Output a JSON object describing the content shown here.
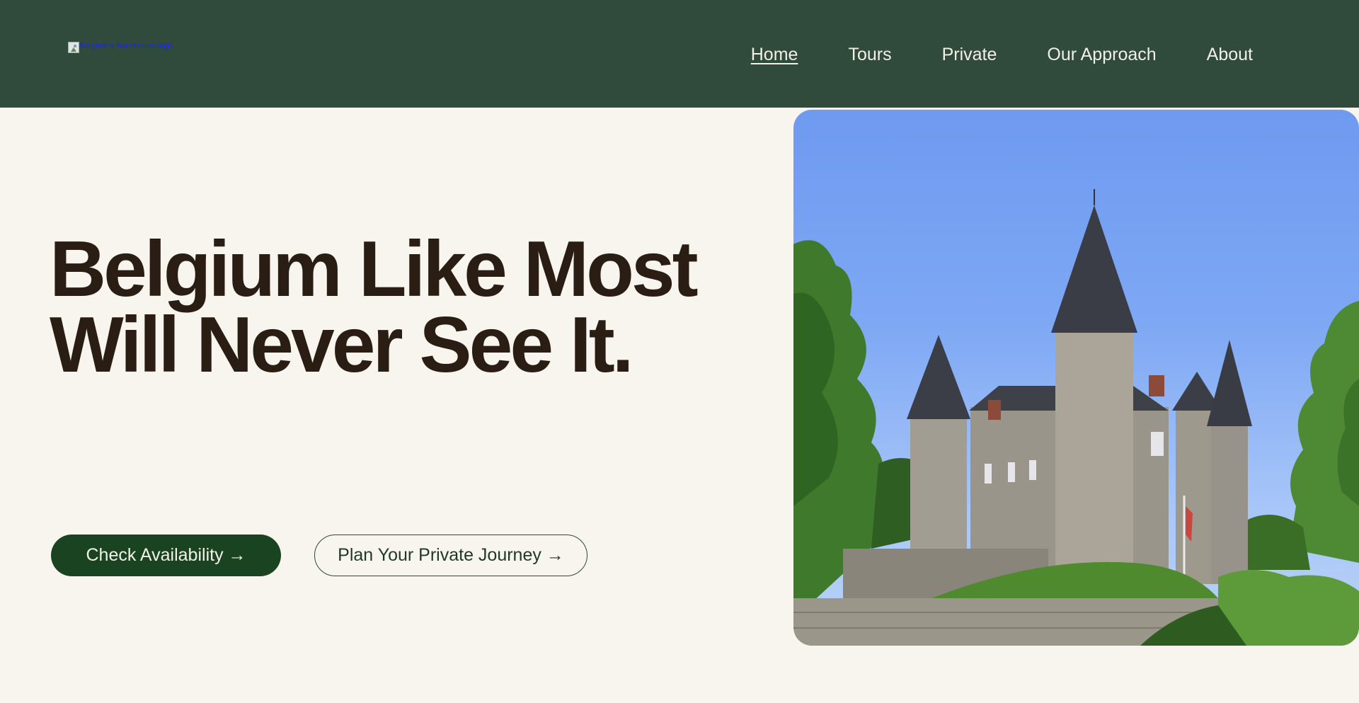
{
  "header": {
    "logo_alt": "Belgium's-Wanderlust-logo",
    "nav": [
      {
        "label": "Home",
        "active": true
      },
      {
        "label": "Tours",
        "active": false
      },
      {
        "label": "Private",
        "active": false
      },
      {
        "label": "Our Approach",
        "active": false
      },
      {
        "label": "About",
        "active": false
      }
    ]
  },
  "hero": {
    "headline_line1": "Belgium Like Most",
    "headline_line2": "Will Never See It.",
    "primary_button": "Check Availability →",
    "secondary_button": "Plan Your Private Journey →"
  },
  "colors": {
    "header_bg": "#304a3c",
    "page_bg": "#f8f4ee",
    "headline": "#2a1e14",
    "primary_button": "#1a4421"
  }
}
